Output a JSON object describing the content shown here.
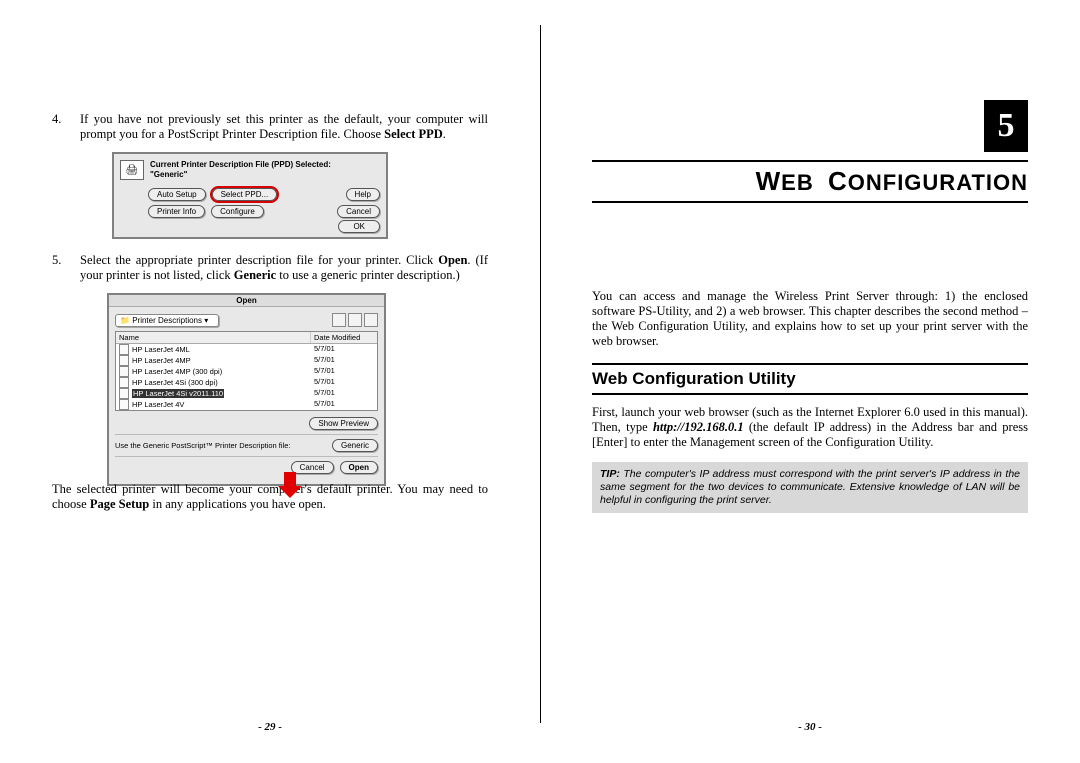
{
  "left": {
    "item4_num": "4.",
    "item4_text_a": "If you have not previously set this printer as the default, your computer will prompt you for a PostScript Printer Description file. Choose ",
    "item4_text_b": "Select PPD",
    "item4_text_c": ".",
    "dlg1": {
      "hdr1": "Current Printer Description File (PPD) Selected:",
      "hdr2": "\"Generic\"",
      "btn_auto": "Auto Setup",
      "btn_select": "Select PPD...",
      "btn_help": "Help",
      "btn_info": "Printer Info",
      "btn_conf": "Configure",
      "btn_cancel": "Cancel",
      "btn_ok": "OK"
    },
    "item5_num": "5.",
    "item5_text_a": "Select the appropriate printer description file for your printer. Click ",
    "item5_text_b": "Open",
    "item5_text_c": ".    (If your printer is not listed, click ",
    "item5_text_d": "Generic",
    "item5_text_e": " to use a generic printer description.)",
    "dlg2": {
      "title": "Open",
      "drop": "Printer Descriptions",
      "col_name": "Name",
      "col_date": "Date Modified",
      "rows": [
        {
          "name": "HP LaserJet 4ML",
          "date": "5/7/01"
        },
        {
          "name": "HP LaserJet 4MP",
          "date": "5/7/01"
        },
        {
          "name": "HP LaserJet 4MP (300 dpi)",
          "date": "5/7/01"
        },
        {
          "name": "HP LaserJet 4Si (300 dpi)",
          "date": "5/7/01"
        },
        {
          "name": "HP LaserJet 4Si v2011.110",
          "date": "5/7/01",
          "sel": true
        },
        {
          "name": "HP LaserJet 4V",
          "date": "5/7/01"
        }
      ],
      "btn_preview": "Show Preview",
      "note": "Use the Generic PostScript™ Printer Description file:",
      "btn_generic": "Generic",
      "btn_cancel": "Cancel",
      "btn_open": "Open"
    },
    "closing_a": "The selected printer will become your computer's default printer. You may need to choose ",
    "closing_b": "Page Setup",
    "closing_c": " in any applications you have open.",
    "page_num": "- 29 -"
  },
  "right": {
    "chapter_num": "5",
    "chapter_title_a": "W",
    "chapter_title_b": "EB",
    "chapter_title_c": "C",
    "chapter_title_d": "ONFIGURATION",
    "intro": "You can access and manage the Wireless Print Server through: 1) the enclosed software PS-Utility, and 2) a web browser.  This chapter describes the second method – the Web Configuration Utility, and explains how to set up your print server with the web browser.",
    "section_title": "Web Configuration Utility",
    "para_a": "First, launch your web browser (such as the Internet Explorer 6.0 used in this manual).  Then, type ",
    "para_b": "http://192.168.0.1",
    "para_c": " (the default IP address) in the Address bar and press [Enter] to enter the Management screen of the Configuration Utility.",
    "tip_label": "TIP:",
    "tip_text": " The computer's IP address must correspond with the print server's IP address in the same segment for the two devices to communicate.  Extensive knowledge of LAN will be helpful in configuring the print server.",
    "page_num": "- 30 -"
  }
}
